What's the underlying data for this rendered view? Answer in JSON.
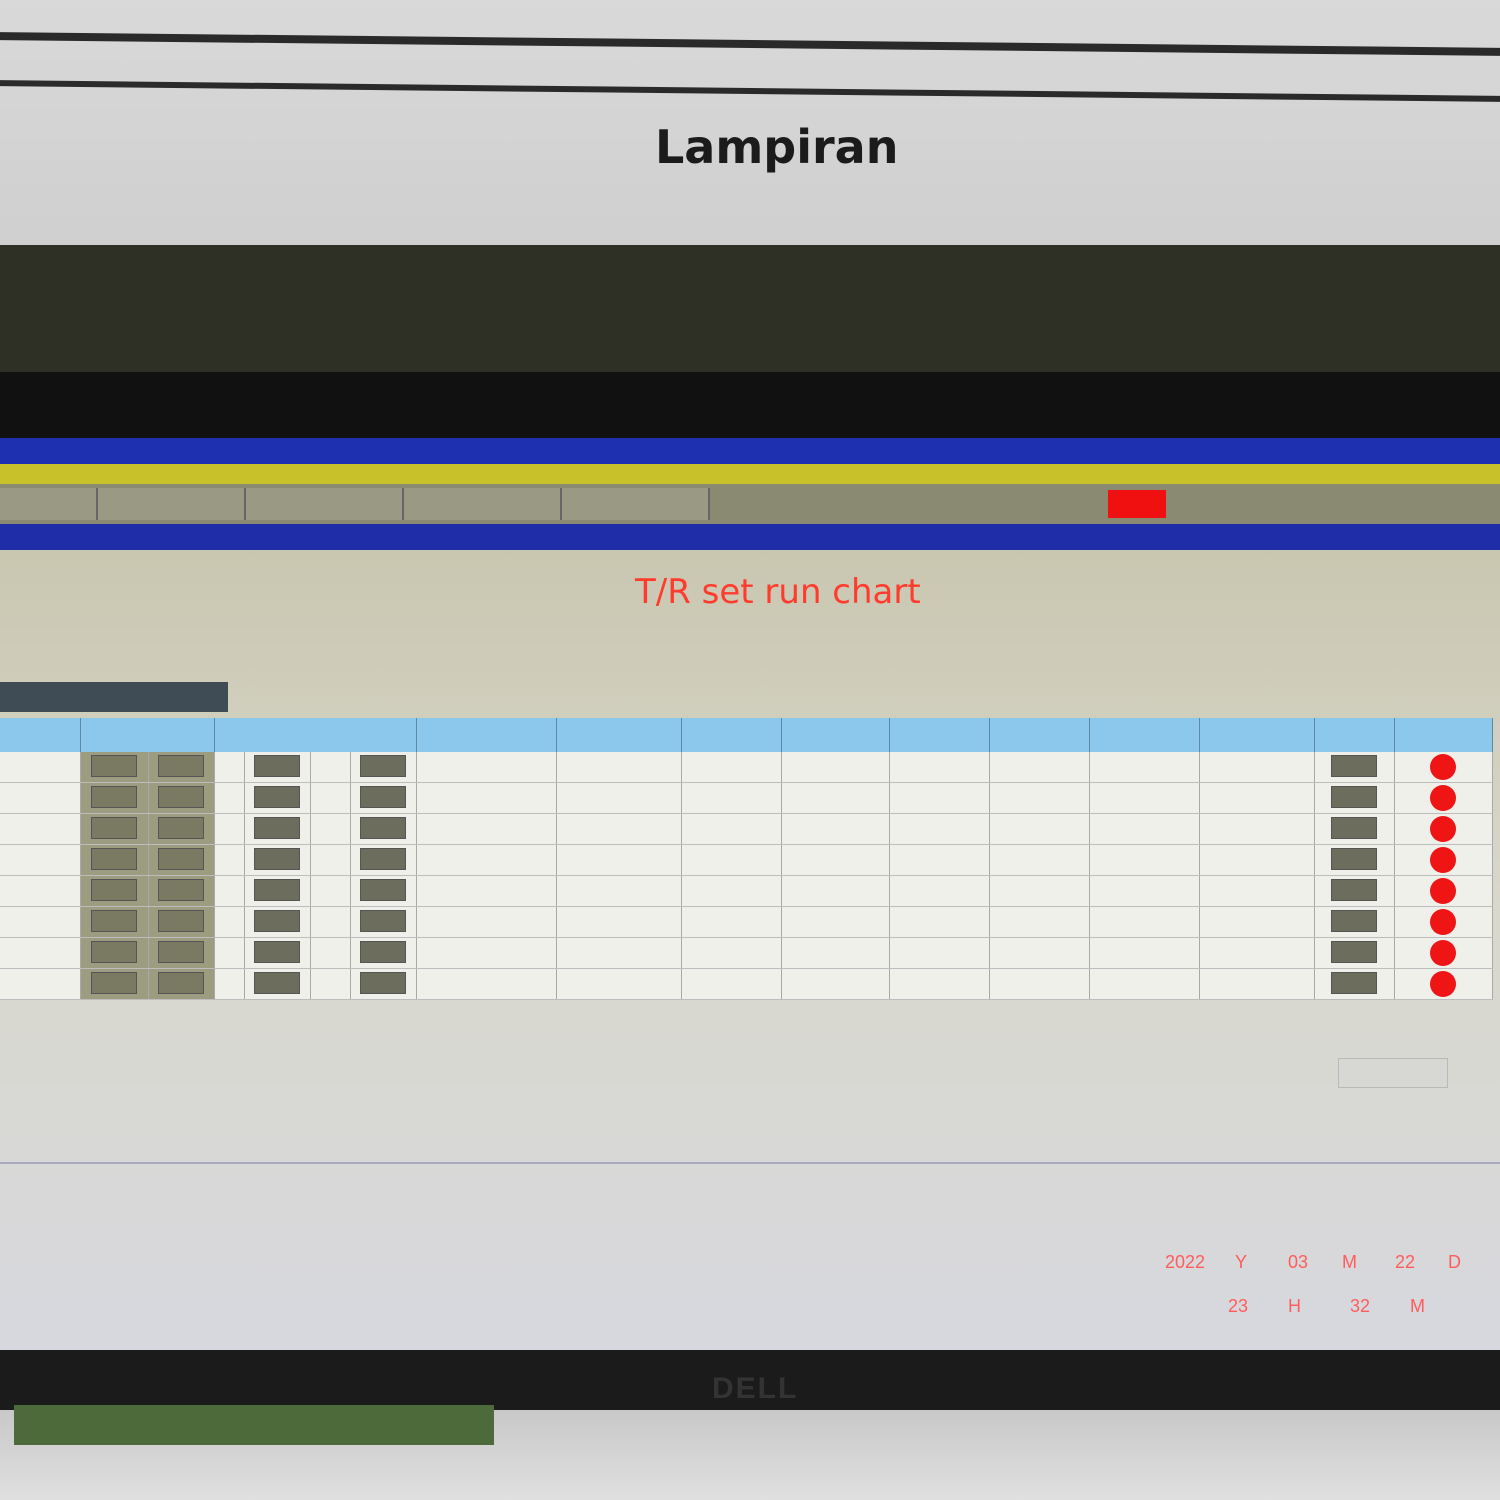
{
  "paper": {
    "title": "Lampiran"
  },
  "window": {
    "title": "",
    "subtitle": ""
  },
  "menu": {
    "items": [
      "",
      "",
      "",
      "",
      ""
    ],
    "alarm_color": "#f01010"
  },
  "page": {
    "title": "T/R set run chart"
  },
  "table": {
    "row_count": 8
  },
  "datetime": {
    "year": "2022",
    "year_unit": "Y",
    "month": "03",
    "month_unit": "M",
    "day": "22",
    "day_unit": "D",
    "hour": "23",
    "hour_unit": "H",
    "minute": "32",
    "minute_unit": "M"
  },
  "monitor": {
    "brand": "DELL"
  },
  "colors": {
    "title_red": "#ff3b2e",
    "status_red": "#ef1515",
    "header_blue": "#8cc8ec"
  }
}
